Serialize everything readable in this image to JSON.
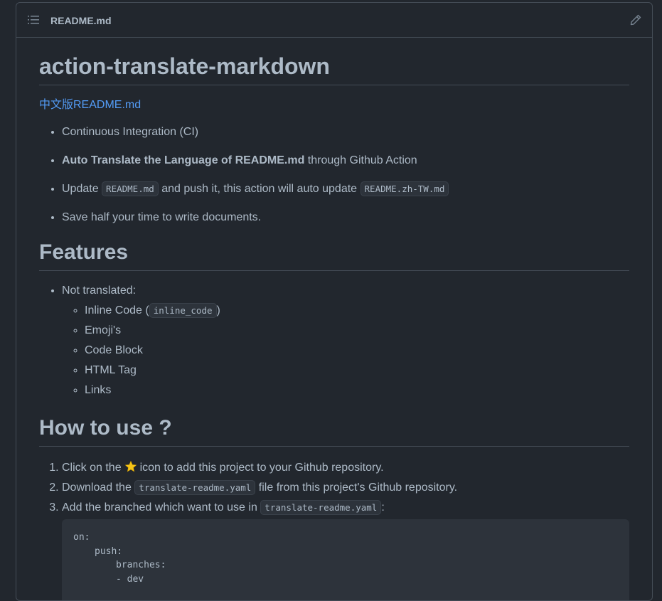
{
  "header": {
    "filename": "README.md",
    "toc_icon": "list-icon",
    "edit_icon": "pencil-icon"
  },
  "article": {
    "title": "action-translate-markdown",
    "chinese_link": "中文版README.md",
    "intro_items": [
      {
        "text": "Continuous Integration (CI)"
      },
      {
        "bold": "Auto Translate the Language of README.md",
        "rest": " through Github Action"
      },
      {
        "pre": "Update ",
        "code1": "README.md",
        "mid": " and push it, this action will auto update ",
        "code2": "README.zh-TW.md"
      },
      {
        "text": "Save half your time to write documents."
      }
    ],
    "features": {
      "heading": "Features",
      "not_translated": "Not translated:",
      "sub_items": [
        {
          "pre": "Inline Code (",
          "code": "inline_code",
          "post": ")"
        },
        {
          "text": "Emoji's"
        },
        {
          "text": "Code Block"
        },
        {
          "text": "HTML Tag"
        },
        {
          "text": "Links"
        }
      ]
    },
    "howto": {
      "heading": "How to use ?",
      "steps": [
        {
          "pre": "Click on the",
          "icon": "star-icon",
          "post": "icon to add this project to your Github repository."
        },
        {
          "pre": "Download the ",
          "code": "translate-readme.yaml",
          "post": " file from this project's Github repository."
        },
        {
          "pre": "Add the branched which want to use in ",
          "code": "translate-readme.yaml",
          "post": ":"
        }
      ],
      "code_lines": [
        "on:",
        "push:",
        "branches:",
        "- dev"
      ]
    }
  },
  "colors": {
    "background": "#22272e",
    "border": "#444c56",
    "text": "#adbac7",
    "link": "#539bf5",
    "code_bg": "#2d333b",
    "star": "#f5c518"
  }
}
